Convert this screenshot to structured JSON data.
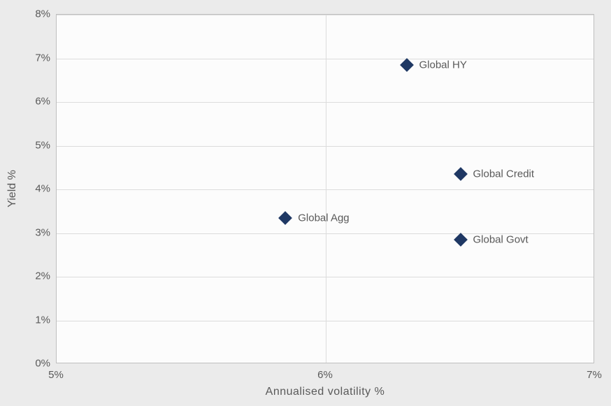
{
  "chart_data": {
    "type": "scatter",
    "title": "",
    "xlabel": "Annualised  volatility %",
    "ylabel": "Yield %",
    "xlim": [
      5,
      7
    ],
    "ylim": [
      0,
      8
    ],
    "x_ticks": [
      "5%",
      "6%",
      "7%"
    ],
    "y_ticks": [
      "0%",
      "1%",
      "2%",
      "3%",
      "4%",
      "5%",
      "6%",
      "7%",
      "8%"
    ],
    "series": [
      {
        "name": "Global Agg",
        "x": 5.85,
        "y": 3.35
      },
      {
        "name": "Global HY",
        "x": 6.3,
        "y": 6.85
      },
      {
        "name": "Global Credit",
        "x": 6.5,
        "y": 4.35
      },
      {
        "name": "Global Govt",
        "x": 6.5,
        "y": 2.85
      }
    ],
    "marker_color": "#1f3864"
  }
}
